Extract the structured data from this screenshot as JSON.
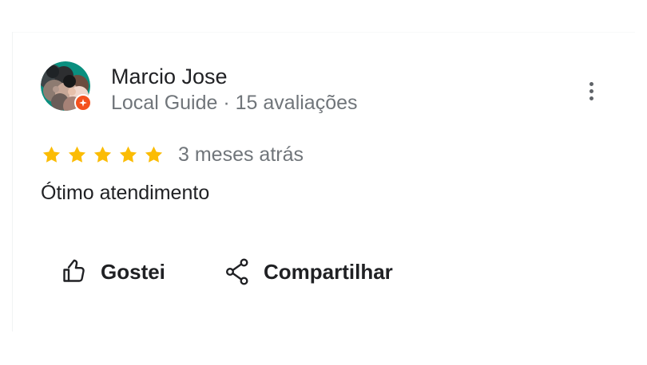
{
  "review": {
    "reviewer": {
      "name": "Marcio Jose",
      "meta": "Local Guide · 15 avaliações",
      "badge_icon": "local-guide-badge-icon"
    },
    "rating": {
      "value": 5,
      "max": 5,
      "star_color": "#fbbc04"
    },
    "date": "3 meses atrás",
    "text": "Ótimo atendimento",
    "more_icon": "more-vertical-icon"
  },
  "actions": {
    "like_label": "Gostei",
    "like_icon": "thumbs-up-icon",
    "share_label": "Compartilhar",
    "share_icon": "share-icon"
  },
  "colors": {
    "text_primary": "#202124",
    "text_secondary": "#70757a",
    "badge_orange": "#f4511e",
    "avatar_bg": "#0a8f7f"
  }
}
